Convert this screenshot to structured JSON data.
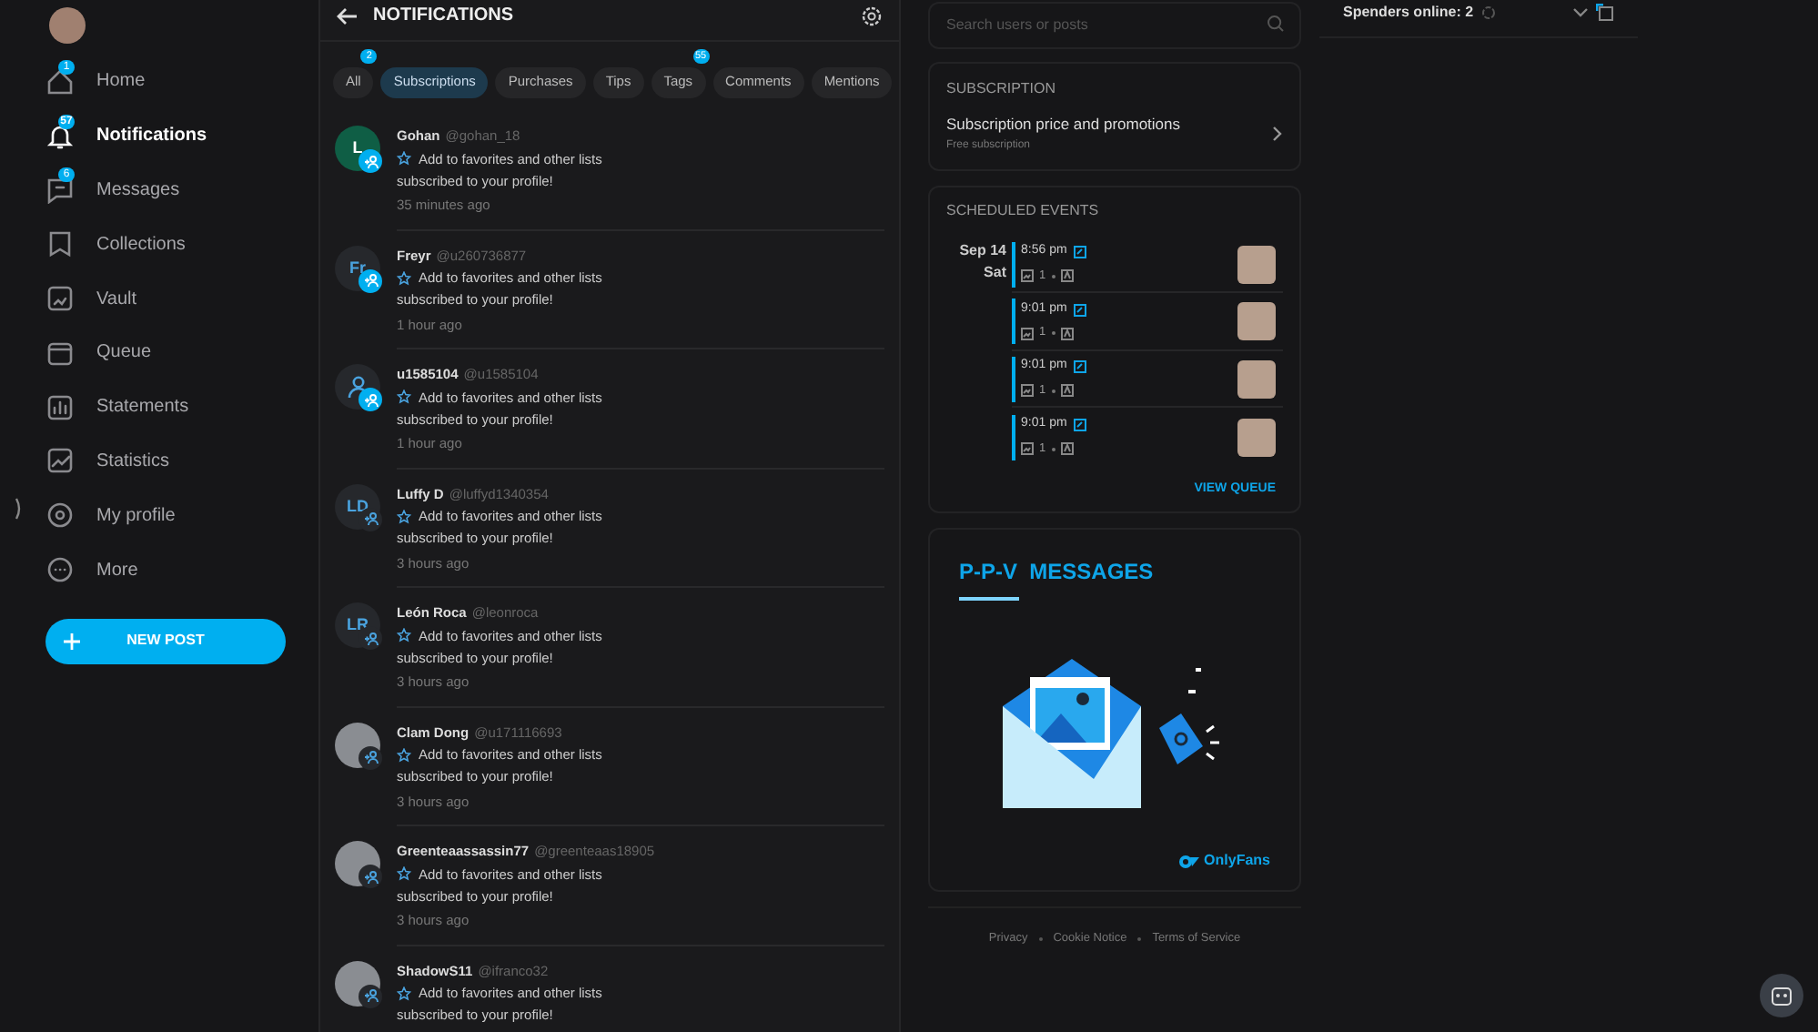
{
  "sidebar": {
    "items": [
      {
        "label": "Home",
        "badge": "1",
        "selected": false
      },
      {
        "label": "Notifications",
        "badge": "57",
        "selected": true
      },
      {
        "label": "Messages",
        "badge": "6",
        "selected": false
      },
      {
        "label": "Collections",
        "selected": false
      },
      {
        "label": "Vault",
        "selected": false
      },
      {
        "label": "Queue",
        "selected": false
      },
      {
        "label": "Statements",
        "selected": false
      },
      {
        "label": "Statistics",
        "selected": false
      },
      {
        "label": "My profile",
        "selected": false
      },
      {
        "label": "More",
        "selected": false
      }
    ],
    "new_post": "NEW POST"
  },
  "header": {
    "title": "NOTIFICATIONS"
  },
  "tabs": [
    {
      "label": "All",
      "badge": "2",
      "selected": false
    },
    {
      "label": "Subscriptions",
      "selected": true
    },
    {
      "label": "Purchases",
      "selected": false
    },
    {
      "label": "Tips",
      "selected": false
    },
    {
      "label": "Tags",
      "badge": "55",
      "selected": false
    },
    {
      "label": "Comments",
      "selected": false
    },
    {
      "label": "Mentions",
      "selected": false
    }
  ],
  "notifications": [
    {
      "name": "Gohan",
      "handle": "@gohan_18",
      "avatar": {
        "kind": "initials",
        "text": "L",
        "color": "#0f5e45"
      },
      "action": "Add to favorites and other lists",
      "message": "subscribed to your profile!",
      "time": "35 minutes ago",
      "highlighted": true
    },
    {
      "name": "Freyr",
      "handle": "@u260736877",
      "avatar": {
        "kind": "initials",
        "text": "Fr"
      },
      "action": "Add to favorites and other lists",
      "message": "subscribed to your profile!",
      "time": "1 hour ago",
      "highlighted": true
    },
    {
      "name": "u1585104",
      "handle": "@u1585104",
      "avatar": {
        "kind": "person"
      },
      "action": "Add to favorites and other lists",
      "message": "subscribed to your profile!",
      "time": "1 hour ago",
      "highlighted": true
    },
    {
      "name": "Luffy D",
      "handle": "@luffyd1340354",
      "avatar": {
        "kind": "initials",
        "text": "LD"
      },
      "action": "Add to favorites and other lists",
      "message": "subscribed to your profile!",
      "time": "3 hours ago",
      "highlighted": false
    },
    {
      "name": "León Roca",
      "handle": "@leonroca",
      "avatar": {
        "kind": "initials",
        "text": "LR"
      },
      "action": "Add to favorites and other lists",
      "message": "subscribed to your profile!",
      "time": "3 hours ago",
      "highlighted": false
    },
    {
      "name": "Clam Dong",
      "handle": "@u171116693",
      "avatar": {
        "kind": "photo"
      },
      "action": "Add to favorites and other lists",
      "message": "subscribed to your profile!",
      "time": "3 hours ago",
      "highlighted": false
    },
    {
      "name": "Greenteaassassin77",
      "handle": "@greenteaas18905",
      "avatar": {
        "kind": "photo"
      },
      "action": "Add to favorites and other lists",
      "message": "subscribed to your profile!",
      "time": "3 hours ago",
      "highlighted": false
    },
    {
      "name": "ShadowS11",
      "handle": "@ifranco32",
      "avatar": {
        "kind": "photo"
      },
      "action": "Add to favorites and other lists",
      "message": "subscribed to your profile!",
      "highlighted": false
    }
  ],
  "search": {
    "placeholder": "Search users or posts"
  },
  "subscription": {
    "heading": "SUBSCRIPTION",
    "title": "Subscription price and promotions",
    "subtitle": "Free subscription"
  },
  "scheduled": {
    "heading": "SCHEDULED EVENTS",
    "date": "Sep 14",
    "weekday": "Sat",
    "events": [
      {
        "time": "8:56 pm",
        "count": "1"
      },
      {
        "time": "9:01 pm",
        "count": "1"
      },
      {
        "time": "9:01 pm",
        "count": "1"
      },
      {
        "time": "9:01 pm",
        "count": "1"
      }
    ],
    "link": "VIEW QUEUE"
  },
  "promo": {
    "title": "P-P-V  MESSAGES",
    "brand": "OnlyFans"
  },
  "footer": [
    "Privacy",
    "Cookie Notice",
    "Terms of Service"
  ],
  "spenders": {
    "label": "Spenders online: 2"
  }
}
